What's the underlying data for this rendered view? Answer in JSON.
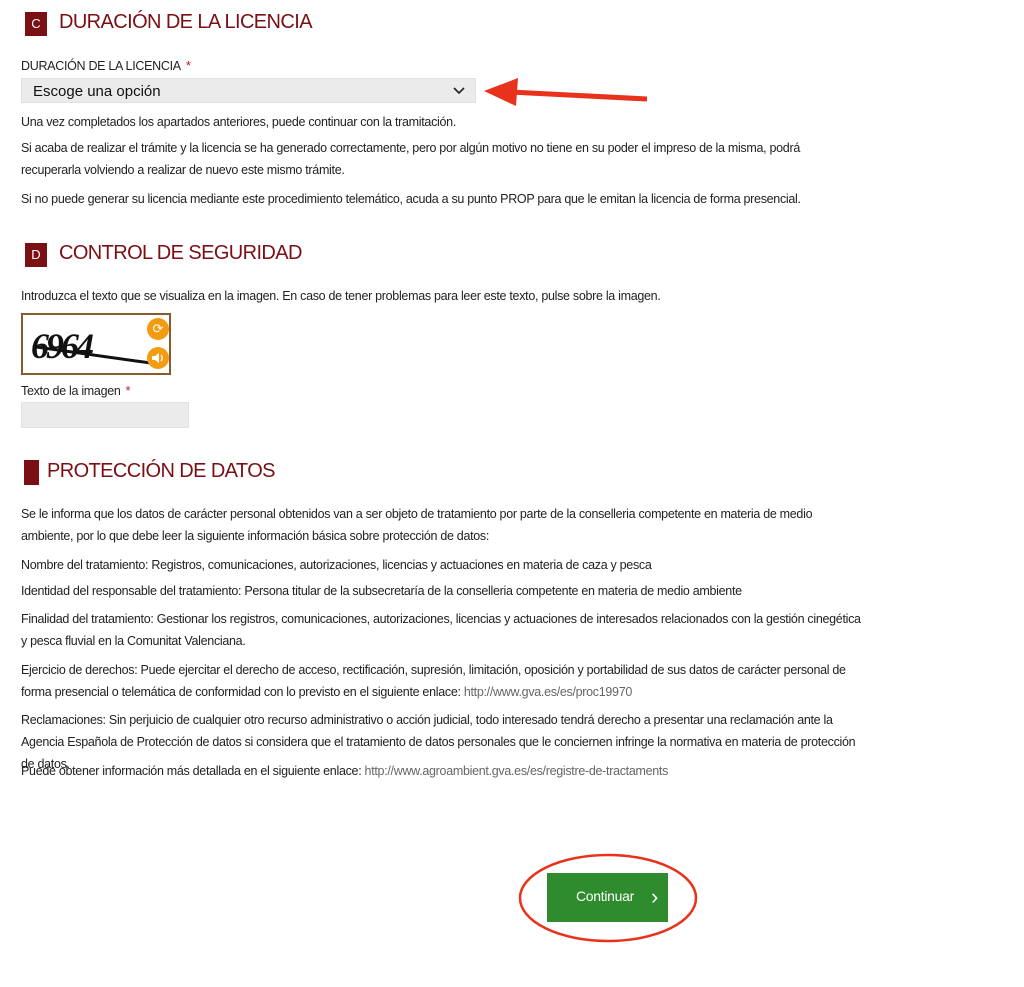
{
  "section_c": {
    "badge": "C",
    "title": "DURACIÓN DE LA LICENCIA",
    "field_label": "DURACIÓN DE LA LICENCIA",
    "required_mark": "*",
    "select_value": "Escoge una opción",
    "paragraphs": [
      "Una vez completados los apartados anteriores, puede continuar con la tramitación.",
      "Si acaba de realizar el trámite y la licencia se ha generado correctamente, pero por algún motivo no tiene en su poder el impreso de la misma, podrá recuperarla volviendo a realizar de nuevo este mismo trámite.",
      "Si no puede generar su licencia mediante este procedimiento telemático, acuda a su punto PROP para que le emitan la licencia de forma presencial."
    ]
  },
  "section_d": {
    "badge": "D",
    "title": "CONTROL DE SEGURIDAD",
    "instructions": "Introduzca el texto que se visualiza en la imagen. En caso de tener problemas para leer este texto, pulse sobre la imagen.",
    "captcha_code": "6964",
    "field_label": "Texto de la imagen",
    "required_mark": "*",
    "field_value": ""
  },
  "privacy": {
    "title": "PROTECCIÓN DE DATOS",
    "p1": "Se le informa que los datos de carácter personal obtenidos van a ser objeto de tratamiento por parte de la conselleria competente en materia de medio ambiente, por lo que debe leer la siguiente información básica sobre protección de datos:",
    "p2": "Nombre del tratamiento: Registros, comunicaciones, autorizaciones, licencias y actuaciones en materia de caza y pesca",
    "p3": "Identidad del responsable del tratamiento: Persona titular de la subsecretaría de la conselleria competente en materia de medio ambiente",
    "p4": "Finalidad del tratamiento: Gestionar los registros, comunicaciones, autorizaciones, licencias y actuaciones de interesados relacionados con la gestión cinegética y pesca fluvial en la Comunitat Valenciana.",
    "p5_text": "Ejercicio de derechos: Puede ejercitar el derecho de acceso, rectificación, supresión, limitación, oposición y portabilidad de sus datos de carácter personal de forma presencial o telemática de conformidad con lo previsto en el siguiente enlace: ",
    "p5_link": "http://www.gva.es/es/proc19970",
    "p6": "Reclamaciones: Sin perjuicio de cualquier otro recurso administrativo o acción judicial, todo interesado tendrá derecho a presentar una reclamación ante la Agencia Española de Protección de datos si considera que el tratamiento de datos personales que le conciernen infringe la normativa en materia de protección de datos.",
    "p7_text": "Puede obtener información más detallada en el siguiente enlace: ",
    "p7_link": "http://www.agroambient.gva.es/es/registre-de-tractaments"
  },
  "continue_button": {
    "label": "Continuar",
    "chevron": "›"
  },
  "colors": {
    "brand": "#7a0f14",
    "button": "#2e8b2e",
    "annotation": "#e8321c"
  },
  "icons": {
    "refresh": "refresh-icon",
    "audio": "speaker-icon",
    "select_arrow": "chevron-down-icon"
  }
}
